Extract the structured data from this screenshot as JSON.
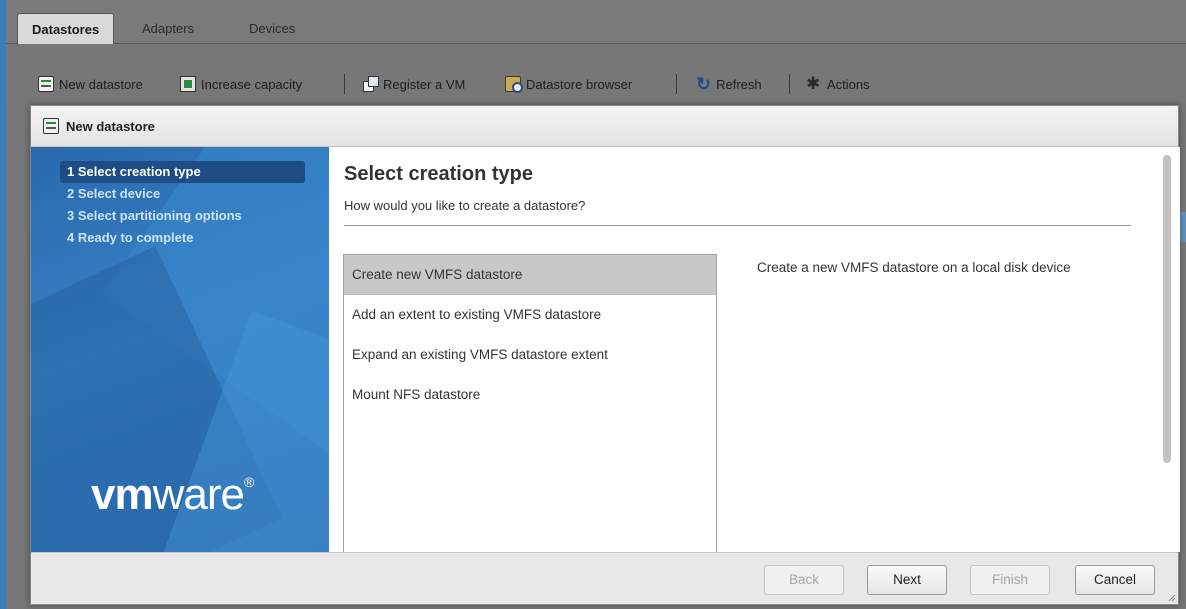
{
  "tabs": [
    {
      "label": "Datastores",
      "active": true
    },
    {
      "label": "Adapters",
      "active": false
    },
    {
      "label": "Devices",
      "active": false
    }
  ],
  "toolbar": {
    "new_datastore": "New datastore",
    "increase_capacity": "Increase capacity",
    "register_vm": "Register a VM",
    "datastore_browser": "Datastore browser",
    "refresh": "Refresh",
    "actions": "Actions"
  },
  "dialog": {
    "title": "New datastore",
    "steps": [
      "1 Select creation type",
      "2 Select device",
      "3 Select partitioning options",
      "4 Ready to complete"
    ],
    "active_step": 0,
    "logo_bold": "vm",
    "logo_rest": "ware",
    "logo_mark": "®",
    "heading": "Select creation type",
    "subheading": "How would you like to create a datastore?",
    "creation_types": [
      "Create new VMFS datastore",
      "Add an extent to existing VMFS datastore",
      "Expand an existing VMFS datastore extent",
      "Mount NFS datastore"
    ],
    "selected_type": 0,
    "description": "Create a new VMFS datastore on a local disk device",
    "buttons": {
      "back": "Back",
      "next": "Next",
      "finish": "Finish",
      "cancel": "Cancel"
    }
  },
  "colors": {
    "wizard_sidebar": "#2e72b8",
    "active_step": "#1d4d84",
    "selected_row": "#c8c8c8"
  }
}
